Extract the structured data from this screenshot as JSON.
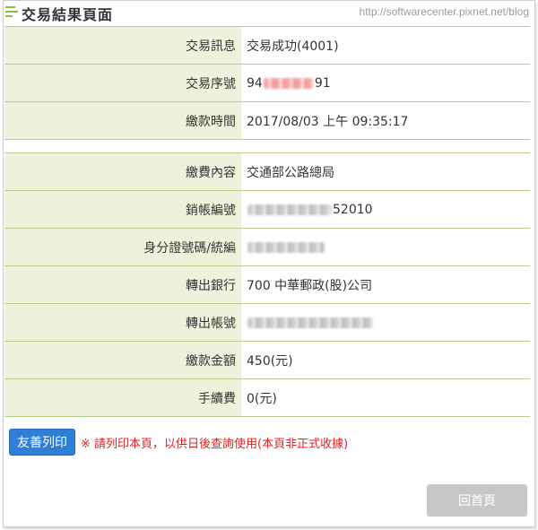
{
  "header": {
    "title": "交易結果頁面",
    "watermark": "http://softwarecenter.pixnet.net/blog"
  },
  "transaction": {
    "message_label": "交易訊息",
    "message_value": "交易成功(4001)",
    "serial_label": "交易序號",
    "serial_prefix": "94",
    "serial_suffix": "91",
    "time_label": "繳款時間",
    "time_value": "2017/08/03 上午 09:35:17"
  },
  "payment": {
    "content_label": "繳費內容",
    "content_value": "交通部公路總局",
    "account_label": "銷帳編號",
    "account_suffix": "52010",
    "id_label": "身分證號碼/統編",
    "bank_label": "轉出銀行",
    "bank_value": "700 中華郵政(股)公司",
    "out_account_label": "轉出帳號",
    "amount_label": "繳款金額",
    "amount_value": "450(元)",
    "fee_label": "手續費",
    "fee_value": "0(元)"
  },
  "actions": {
    "print_label": "友善列印",
    "print_note": "※ 請列印本頁，以供日後查詢使用(本頁非正式收據)",
    "home_label": "回首頁"
  },
  "colors": {
    "accent_green": "#8cbf3f",
    "label_bg": "#eef2dc",
    "row_border": "#b7cf8a",
    "highlight_red": "#e02020",
    "print_button": "#2f7fd6",
    "home_button_disabled": "#c7c7c7"
  },
  "icons": {
    "header_icon": "menu-lines-icon"
  }
}
